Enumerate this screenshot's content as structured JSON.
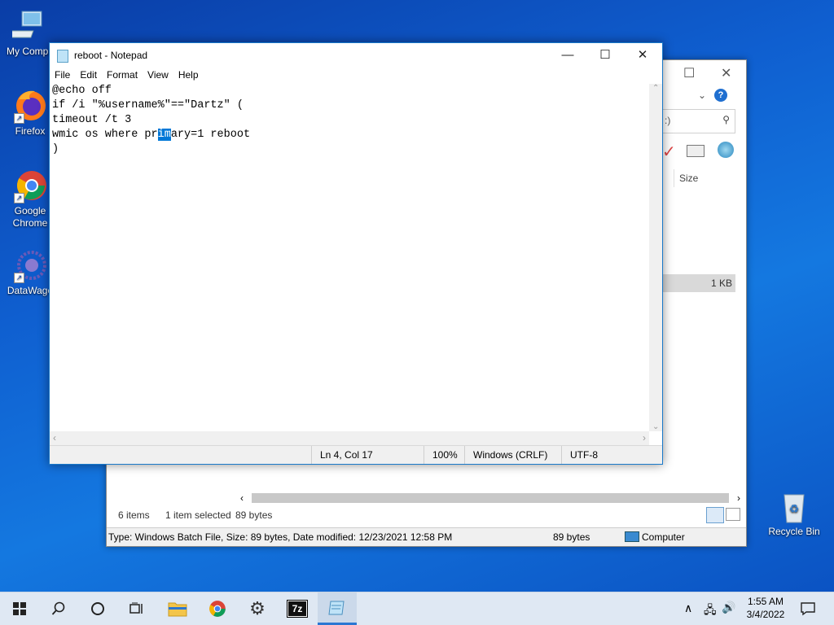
{
  "desktop": {
    "icons": [
      {
        "label": "My Compu"
      },
      {
        "label": "Firefox"
      },
      {
        "label": "Google Chrome"
      },
      {
        "label": "DataWago"
      },
      {
        "label": "Recycle Bin"
      }
    ]
  },
  "explorer": {
    "column_size": "Size",
    "file_size": "1 KB",
    "search_suffix": ":)",
    "items_count": "6 items",
    "selection": "1 item selected",
    "selection_size": "89 bytes",
    "status_text": "Type: Windows Batch File, Size: 89 bytes, Date modified: 12/23/2021 12:58 PM",
    "status_size": "89 bytes",
    "status_location": "Computer"
  },
  "notepad": {
    "title": "reboot - Notepad",
    "menu": [
      "File",
      "Edit",
      "Format",
      "View",
      "Help"
    ],
    "lines": [
      "@echo off",
      "if /i \"%username%\"==\"Dartz\" (",
      "timeout /t 3"
    ],
    "line4_before": "wmic os where pr",
    "line4_selected": "im",
    "line4_after": "ary=1 reboot",
    "line5": ")",
    "status": {
      "position": "Ln 4, Col 17",
      "zoom": "100%",
      "line_ending": "Windows (CRLF)",
      "encoding": "UTF-8"
    }
  },
  "taskbar": {
    "time": "1:55 AM",
    "date": "3/4/2022",
    "seven_zip_label": "7z"
  }
}
